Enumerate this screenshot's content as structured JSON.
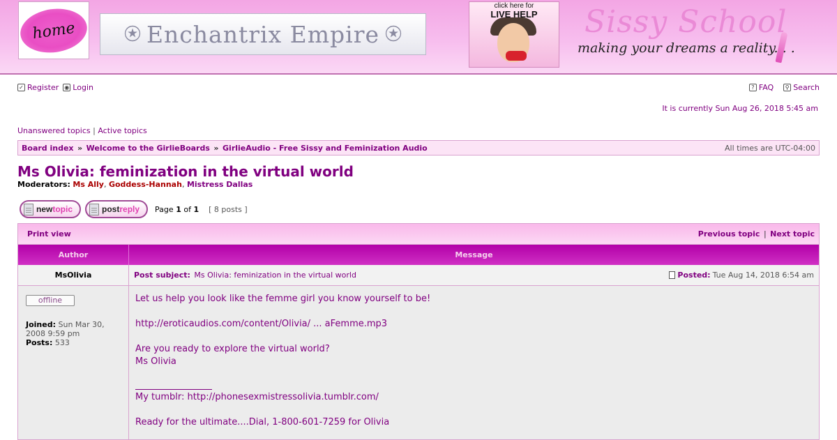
{
  "header": {
    "home_logo_text": "home",
    "banner_title": "Enchantrix Empire",
    "live_help_line1": "click here for",
    "live_help_line2": "LIVE HELP",
    "sissy_title": "Sissy School",
    "sissy_tagline": "making your dreams a reality. . ."
  },
  "nav": {
    "register": "Register",
    "login": "Login",
    "faq": "FAQ",
    "search": "Search"
  },
  "current_time": "It is currently Sun Aug 26, 2018 5:45 am",
  "quick_links": {
    "unanswered": "Unanswered topics",
    "separator": "|",
    "active": "Active topics"
  },
  "breadcrumb": {
    "items": [
      "Board index",
      "Welcome to the GirlieBoards",
      "GirlieAudio - Free Sissy and Feminization Audio"
    ],
    "separator": "»",
    "timezone": "All times are UTC-04:00"
  },
  "topic": {
    "title": "Ms Olivia: feminization in the virtual world",
    "moderators_label": "Moderators:",
    "moderators": [
      "Ms Ally",
      "Goddess-Hannah",
      "Mistress Dallas"
    ]
  },
  "actions": {
    "new_topic_a": "new",
    "new_topic_b": "topic",
    "post_reply_a": "post",
    "post_reply_b": "reply",
    "page_prefix": "Page",
    "page_current": "1",
    "page_of": "of",
    "page_total": "1",
    "post_count": "[ 8 posts ]"
  },
  "table": {
    "print_view": "Print view",
    "previous_topic": "Previous topic",
    "nav_separator": "|",
    "next_topic": "Next topic",
    "col_author": "Author",
    "col_message": "Message"
  },
  "post": {
    "author": "MsOlivia",
    "subject_label": "Post subject:",
    "subject": "Ms Olivia: feminization in the virtual world",
    "posted_label": "Posted:",
    "posted_date": "Tue Aug 14, 2018 6:54 am",
    "status": "offline",
    "joined_label": "Joined:",
    "joined_value": "Sun Mar 30, 2008 9:59 pm",
    "posts_label": "Posts:",
    "posts_value": "533",
    "body": {
      "line1": "Let us help you look like the femme girl you know yourself to be!",
      "link1": "http://eroticaudios.com/content/Olivia/ ... aFemme.mp3",
      "line2": "Are you ready to explore the virtual world?",
      "line3": "Ms Olivia",
      "sig_label": "My tumblr: ",
      "sig_link": "http://phonesexmistressolivia.tumblr.com/",
      "sig_line2": "Ready for the ultimate....Dial, 1-800-601-7259 for Olivia"
    }
  },
  "colors": {
    "accent": "#800080",
    "header_pink": "#f7bdee",
    "table_head": "#c018b6"
  }
}
